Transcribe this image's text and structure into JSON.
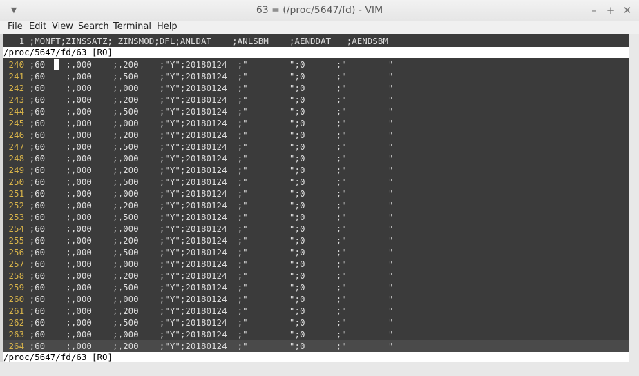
{
  "window": {
    "title": "63 = (/proc/5647/fd) - VIM",
    "menu_icon": "chevron-down-icon",
    "controls": [
      "minimize-icon",
      "maximize-icon",
      "close-icon"
    ]
  },
  "menu": [
    "File",
    "Edit",
    "View",
    "Search",
    "Terminal",
    "Help"
  ],
  "top_pane": {
    "line": "   1 ;MONFT;ZINSSATZ; ZINSMOD;DFL;ANLDAT    ;ANLSBM    ;AENDDAT   ;AENDSBM",
    "status": "/proc/5647/fd/63 [RO]"
  },
  "bottom_pane": {
    "lines": [
      {
        "num": "240",
        "text": " ;60    ;,000    ;,200    ;\"Y\";20180124  ;\"        \";0      ;\"        \""
      },
      {
        "num": "241",
        "text": " ;60    ;,000    ;,500    ;\"Y\";20180124  ;\"        \";0      ;\"        \""
      },
      {
        "num": "242",
        "text": " ;60    ;,000    ;,000    ;\"Y\";20180124  ;\"        \";0      ;\"        \""
      },
      {
        "num": "243",
        "text": " ;60    ;,000    ;,200    ;\"Y\";20180124  ;\"        \";0      ;\"        \""
      },
      {
        "num": "244",
        "text": " ;60    ;,000    ;,500    ;\"Y\";20180124  ;\"        \";0      ;\"        \""
      },
      {
        "num": "245",
        "text": " ;60    ;,000    ;,000    ;\"Y\";20180124  ;\"        \";0      ;\"        \""
      },
      {
        "num": "246",
        "text": " ;60    ;,000    ;,200    ;\"Y\";20180124  ;\"        \";0      ;\"        \""
      },
      {
        "num": "247",
        "text": " ;60    ;,000    ;,500    ;\"Y\";20180124  ;\"        \";0      ;\"        \""
      },
      {
        "num": "248",
        "text": " ;60    ;,000    ;,000    ;\"Y\";20180124  ;\"        \";0      ;\"        \""
      },
      {
        "num": "249",
        "text": " ;60    ;,000    ;,200    ;\"Y\";20180124  ;\"        \";0      ;\"        \""
      },
      {
        "num": "250",
        "text": " ;60    ;,000    ;,500    ;\"Y\";20180124  ;\"        \";0      ;\"        \""
      },
      {
        "num": "251",
        "text": " ;60    ;,000    ;,000    ;\"Y\";20180124  ;\"        \";0      ;\"        \""
      },
      {
        "num": "252",
        "text": " ;60    ;,000    ;,200    ;\"Y\";20180124  ;\"        \";0      ;\"        \""
      },
      {
        "num": "253",
        "text": " ;60    ;,000    ;,500    ;\"Y\";20180124  ;\"        \";0      ;\"        \""
      },
      {
        "num": "254",
        "text": " ;60    ;,000    ;,000    ;\"Y\";20180124  ;\"        \";0      ;\"        \""
      },
      {
        "num": "255",
        "text": " ;60    ;,000    ;,200    ;\"Y\";20180124  ;\"        \";0      ;\"        \""
      },
      {
        "num": "256",
        "text": " ;60    ;,000    ;,500    ;\"Y\";20180124  ;\"        \";0      ;\"        \""
      },
      {
        "num": "257",
        "text": " ;60    ;,000    ;,000    ;\"Y\";20180124  ;\"        \";0      ;\"        \""
      },
      {
        "num": "258",
        "text": " ;60    ;,000    ;,200    ;\"Y\";20180124  ;\"        \";0      ;\"        \""
      },
      {
        "num": "259",
        "text": " ;60    ;,000    ;,500    ;\"Y\";20180124  ;\"        \";0      ;\"        \""
      },
      {
        "num": "260",
        "text": " ;60    ;,000    ;,000    ;\"Y\";20180124  ;\"        \";0      ;\"        \""
      },
      {
        "num": "261",
        "text": " ;60    ;,000    ;,200    ;\"Y\";20180124  ;\"        \";0      ;\"        \""
      },
      {
        "num": "262",
        "text": " ;60    ;,000    ;,500    ;\"Y\";20180124  ;\"        \";0      ;\"        \""
      },
      {
        "num": "263",
        "text": " ;60    ;,000    ;,000    ;\"Y\";20180124  ;\"        \";0      ;\"        \""
      },
      {
        "num": "264",
        "text": " ;60    ;,000    ;,200    ;\"Y\";20180124  ;\"        \";0      ;\"        \""
      }
    ],
    "status": "/proc/5647/fd/63 [RO]"
  }
}
